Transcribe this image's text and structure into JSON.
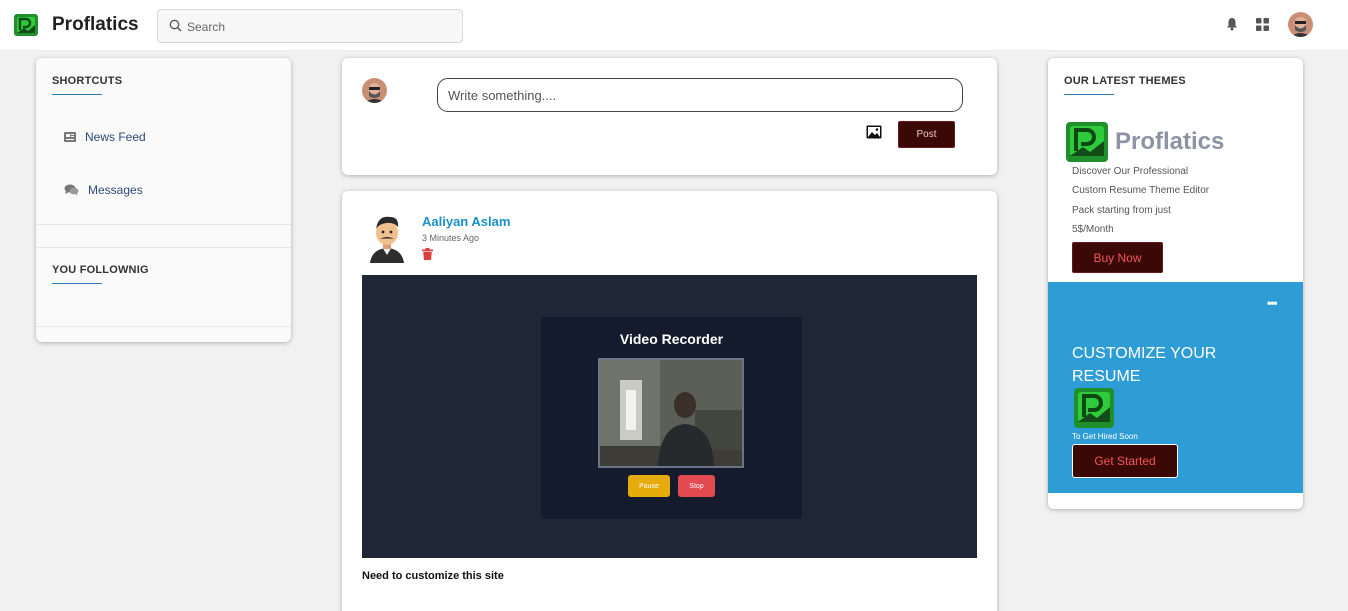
{
  "app": {
    "brand": "Proflatics",
    "logo_icon": "proflatics-logo-icon"
  },
  "topbar": {
    "search_placeholder": "Search",
    "icons": [
      "search-icon",
      "bell-icon",
      "apps-grid-icon",
      "user-avatar"
    ]
  },
  "sidebar": {
    "shortcuts_title": "SHORTCUTS",
    "items": [
      {
        "label": "News Feed",
        "icon": "newspaper-icon"
      },
      {
        "label": "Messages",
        "icon": "chat-bubbles-icon"
      }
    ],
    "following_title": "YOU FOLLOWNIG"
  },
  "composer": {
    "placeholder": "Write something....",
    "post_label": "Post",
    "image_icon": "image-icon"
  },
  "post": {
    "author": "Aaliyan Aslam",
    "time": "3 Minutes Ago",
    "caption": "Need to customize this site",
    "recorder": {
      "title": "Video Recorder",
      "pause_label": "Pause",
      "stop_label": "Stop"
    }
  },
  "themes": {
    "title": "OUR LATEST THEMES",
    "brand": "Proflatics",
    "lines": [
      "Discover Our Professional",
      "Custom Resume Theme Editor",
      "Pack starting from just",
      "5$/Month"
    ],
    "buy_label": "Buy Now"
  },
  "promo": {
    "title": "CUSTOMIZE YOUR RESUME",
    "subtitle": "To Get Hired Soon",
    "button_label": "Get Started"
  },
  "colors": {
    "accent_blue": "#2e9dd6",
    "link_blue": "#1a8fc8",
    "dark_maroon": "#3b0808",
    "danger_red": "#e24a4f",
    "warning_yellow": "#e5ac0c"
  }
}
